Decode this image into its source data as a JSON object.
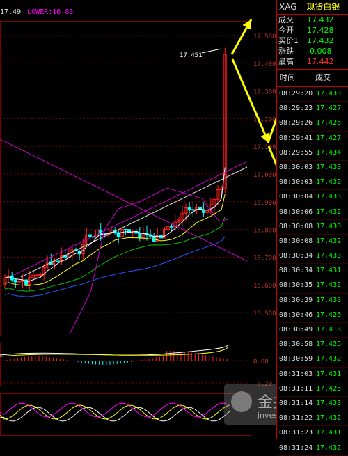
{
  "indicator_bar": {
    "mid": "17.49",
    "lower": "LOWER:16.83"
  },
  "annotation": {
    "peak_label": "17.451"
  },
  "axis": {
    "price_ticks": [
      "17.500",
      "17.400",
      "17.300",
      "17.200",
      "17.100",
      "17.000",
      "16.900",
      "16.800",
      "16.700",
      "16.600",
      "16.500"
    ],
    "macd_ticks": [
      "0.00",
      "-0.20"
    ]
  },
  "quote": {
    "symbol": "XAG",
    "name": "现货白银",
    "rows": [
      {
        "label": "成交",
        "value": "17.432",
        "color": "#00ff00"
      },
      {
        "label": "今开",
        "value": "17.428",
        "color": "#00ff00"
      },
      {
        "label": "买价1",
        "value": "17.432",
        "color": "#00ff00"
      },
      {
        "label": "涨跌",
        "value": "-0.008",
        "color": "#00ff00"
      },
      {
        "label": "最高",
        "value": "17.442",
        "color": "#ff3030"
      }
    ]
  },
  "ticks_header": {
    "time": "时间",
    "price": "成交"
  },
  "ticks": [
    {
      "time": "08:29:20",
      "price": "17.433"
    },
    {
      "time": "08:29:23",
      "price": "17.427"
    },
    {
      "time": "08:29:26",
      "price": "17.426"
    },
    {
      "time": "08:29:41",
      "price": "17.427"
    },
    {
      "time": "08:29:55",
      "price": "17.434"
    },
    {
      "time": "08:30:03",
      "price": "17.433"
    },
    {
      "time": "08:30:03",
      "price": "17.432"
    },
    {
      "time": "08:30:04",
      "price": "17.433"
    },
    {
      "time": "08:30:06",
      "price": "17.432"
    },
    {
      "time": "08:30:08",
      "price": "17.430"
    },
    {
      "time": "08:30:08",
      "price": "17.432"
    },
    {
      "time": "08:30:34",
      "price": "17.433"
    },
    {
      "time": "08:30:34",
      "price": "17.431"
    },
    {
      "time": "08:30:35",
      "price": "17.432"
    },
    {
      "time": "08:30:39",
      "price": "17.433"
    },
    {
      "time": "08:30:46",
      "price": "17.426"
    },
    {
      "time": "08:30:49",
      "price": "17.418"
    },
    {
      "time": "08:30:58",
      "price": "17.425"
    },
    {
      "time": "08:30:59",
      "price": "17.432"
    },
    {
      "time": "08:31:03",
      "price": "17.431"
    },
    {
      "time": "08:31:11",
      "price": "17.425"
    },
    {
      "time": "08:31:14",
      "price": "17.433"
    },
    {
      "time": "08:31:22",
      "price": "17.432"
    },
    {
      "time": "08:31:23",
      "price": "17.431"
    },
    {
      "time": "08:31:24",
      "price": "17.432"
    }
  ],
  "watermark": {
    "text": "金投网",
    "url": "jnvest"
  },
  "colors": {
    "up": "#ff2020",
    "down": "#00ffff",
    "grid": "#7a0000",
    "trendline": "#cc00cc",
    "arrow": "#ffff00"
  }
}
